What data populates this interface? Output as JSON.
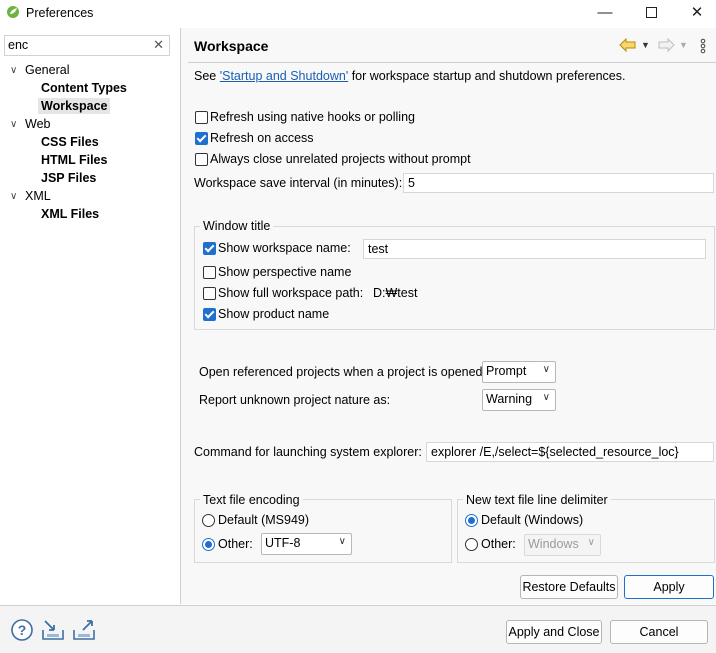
{
  "window": {
    "title": "Preferences"
  },
  "filter": {
    "value": "enc"
  },
  "tree": {
    "general": "General",
    "content_types": "Content Types",
    "workspace": "Workspace",
    "web": "Web",
    "css_files": "CSS Files",
    "html_files": "HTML Files",
    "jsp_files": "JSP Files",
    "xml": "XML",
    "xml_files": "XML Files"
  },
  "page": {
    "title": "Workspace",
    "see_prefix": "See",
    "see_link": "'Startup and Shutdown'",
    "see_suffix": "for workspace startup and shutdown preferences."
  },
  "options": {
    "refresh_native": {
      "label": "Refresh using native hooks or polling",
      "checked": false
    },
    "refresh_access": {
      "label": "Refresh on access",
      "checked": true
    },
    "always_close": {
      "label": "Always close unrelated projects without prompt",
      "checked": false
    },
    "save_interval_label": "Workspace save interval (in minutes):",
    "save_interval_value": "5"
  },
  "window_title_group": {
    "title": "Window title",
    "show_ws_name": {
      "label": "Show workspace name:",
      "checked": true,
      "value": "test"
    },
    "show_persp_name": {
      "label": "Show perspective name",
      "checked": false
    },
    "show_full_path": {
      "label": "Show full workspace path:",
      "checked": false,
      "value": "D:₩test"
    },
    "show_product": {
      "label": "Show product name",
      "checked": true
    }
  },
  "projects": {
    "open_ref_label": "Open referenced projects when a project is opened:",
    "open_ref_value": "Prompt",
    "unknown_nature_label": "Report unknown project nature as:",
    "unknown_nature_value": "Warning"
  },
  "explorer": {
    "label": "Command for launching system explorer:",
    "value": "explorer /E,/select=${selected_resource_loc}"
  },
  "encoding": {
    "title": "Text file encoding",
    "default_label": "Default (MS949)",
    "other_label": "Other:",
    "other_value": "UTF-8",
    "selected": "other"
  },
  "delimiter": {
    "title": "New text file line delimiter",
    "default_label": "Default (Windows)",
    "other_label": "Other:",
    "other_value": "Windows",
    "selected": "default"
  },
  "buttons": {
    "restore": "Restore Defaults",
    "apply": "Apply",
    "apply_close": "Apply and Close",
    "cancel": "Cancel"
  },
  "colors": {
    "accent": "#1f6fd0",
    "link": "#1a5fb4"
  }
}
